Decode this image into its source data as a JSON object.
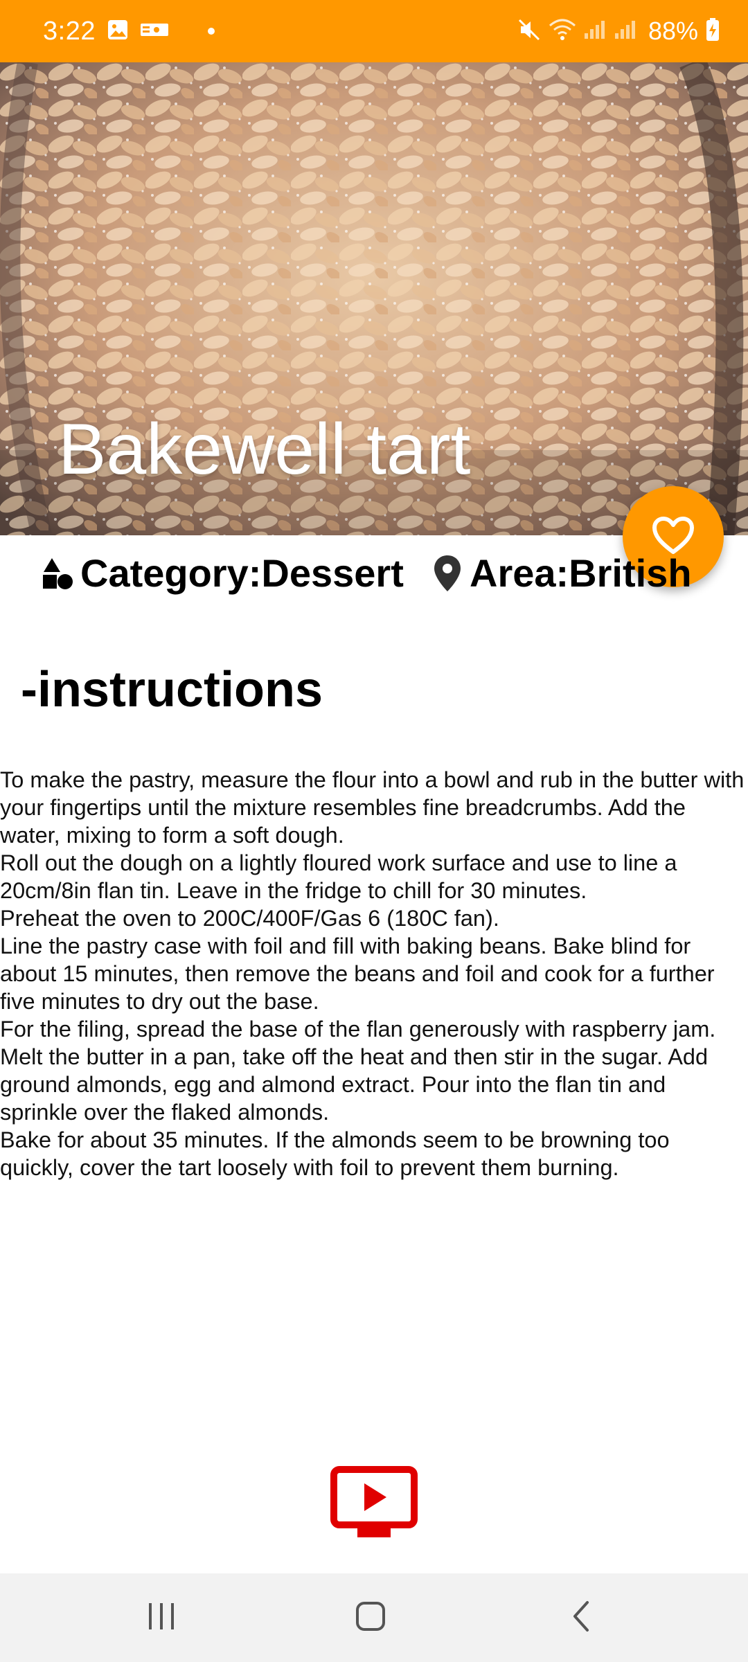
{
  "status_bar": {
    "time": "3:22",
    "battery": "88%",
    "background_color": "#FF9800",
    "icons": [
      "gallery-icon",
      "notification-app-icon",
      "mute-icon",
      "wifi-icon",
      "signal-icon",
      "battery-charging-icon"
    ]
  },
  "meal": {
    "title": "Bakewell tart",
    "category": "Category:Dessert",
    "area": "Area:British",
    "image_description_icon": "meal-photo"
  },
  "favorite_button": {
    "icon": "heart-outline-icon",
    "color": "#FF9800"
  },
  "instructions": {
    "heading": "-instructions",
    "lines": [
      "To make the pastry, measure the flour into a bowl and rub in the butter with your fingertips until the mixture resembles fine breadcrumbs. Add the water, mixing to form a soft dough.",
      "Roll out the dough on a lightly floured work surface and use to line a 20cm/8in flan tin. Leave in the fridge to chill for 30 minutes.",
      "Preheat the oven to 200C/400F/Gas 6 (180C fan).",
      "Line the pastry case with foil and fill with baking beans. Bake blind for about 15 minutes, then remove the beans and foil and cook for a further five minutes to dry out the base.",
      "For the filing, spread the base of the flan generously with raspberry jam.",
      "Melt the butter in a pan, take off the heat and then stir in the sugar. Add ground almonds, egg and almond extract. Pour into the flan tin and sprinkle over the flaked almonds.",
      "Bake for about 35 minutes. If the almonds seem to be browning too quickly, cover the tart loosely with foil to prevent them burning."
    ]
  },
  "video_button": {
    "icon": "youtube-tv-icon",
    "color": "#E00000"
  },
  "nav_bar": {
    "icons": [
      "recents-icon",
      "home-icon",
      "back-icon"
    ]
  }
}
